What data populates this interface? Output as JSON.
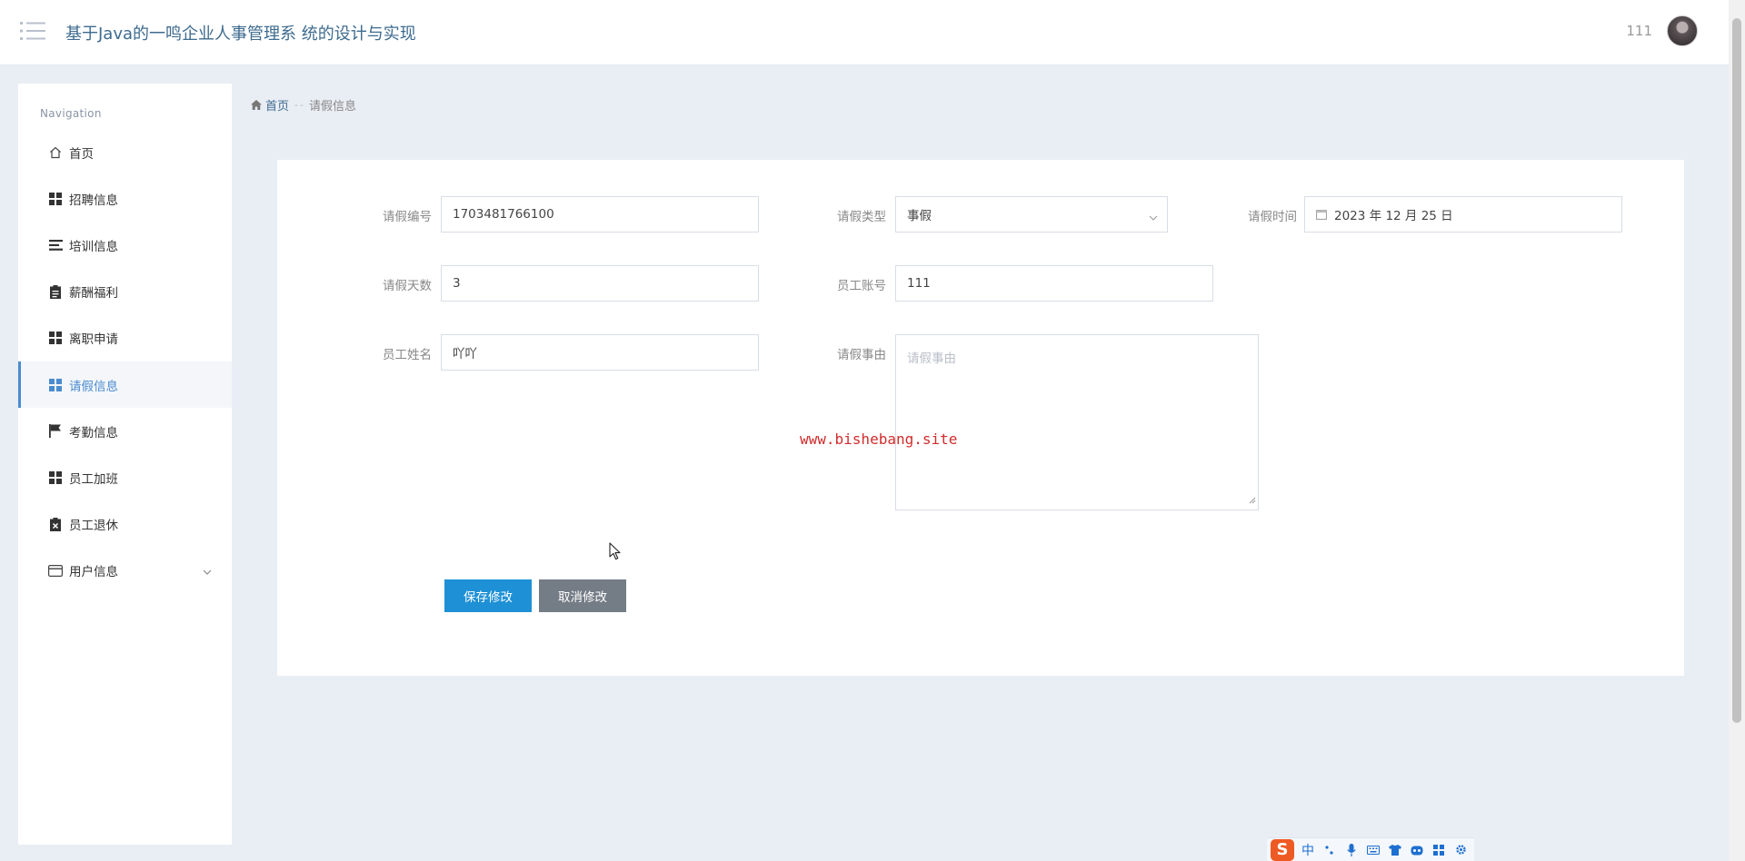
{
  "header": {
    "title": "基于Java的一鸣企业人事管理系 统的设计与实现",
    "user_name": "111"
  },
  "sidebar": {
    "heading": "Navigation",
    "items": [
      {
        "label": "首页",
        "icon": "home-icon"
      },
      {
        "label": "招聘信息",
        "icon": "grid-icon"
      },
      {
        "label": "培训信息",
        "icon": "list-icon"
      },
      {
        "label": "薪酬福利",
        "icon": "clipboard-icon"
      },
      {
        "label": "离职申请",
        "icon": "grid-icon"
      },
      {
        "label": "请假信息",
        "icon": "grid-icon",
        "active": true
      },
      {
        "label": "考勤信息",
        "icon": "flag-icon"
      },
      {
        "label": "员工加班",
        "icon": "grid-icon"
      },
      {
        "label": "员工退休",
        "icon": "clipboard-x-icon"
      },
      {
        "label": "用户信息",
        "icon": "id-card-icon",
        "expandable": true
      }
    ]
  },
  "breadcrumb": {
    "home": "首页",
    "separator": "-",
    "current": "请假信息"
  },
  "form": {
    "leave_no": {
      "label": "请假编号",
      "value": "1703481766100"
    },
    "leave_type": {
      "label": "请假类型",
      "value": "事假"
    },
    "leave_time": {
      "label": "请假时间",
      "value": "2023 年 12 月 25 日"
    },
    "leave_days": {
      "label": "请假天数",
      "value": "3"
    },
    "employee_account": {
      "label": "员工账号",
      "value": "111"
    },
    "employee_name": {
      "label": "员工姓名",
      "value": "吖吖"
    },
    "leave_reason": {
      "label": "请假事由",
      "value": "",
      "placeholder": "请假事由"
    }
  },
  "buttons": {
    "save": "保存修改",
    "cancel": "取消修改"
  },
  "watermark": "www.bishebang.site",
  "ime": {
    "logo": "S",
    "mode": "中"
  },
  "colors": {
    "accent": "#1e90d6",
    "active_nav": "#4a8ccf",
    "title": "#3e6b8f",
    "watermark": "#d12c2c"
  }
}
